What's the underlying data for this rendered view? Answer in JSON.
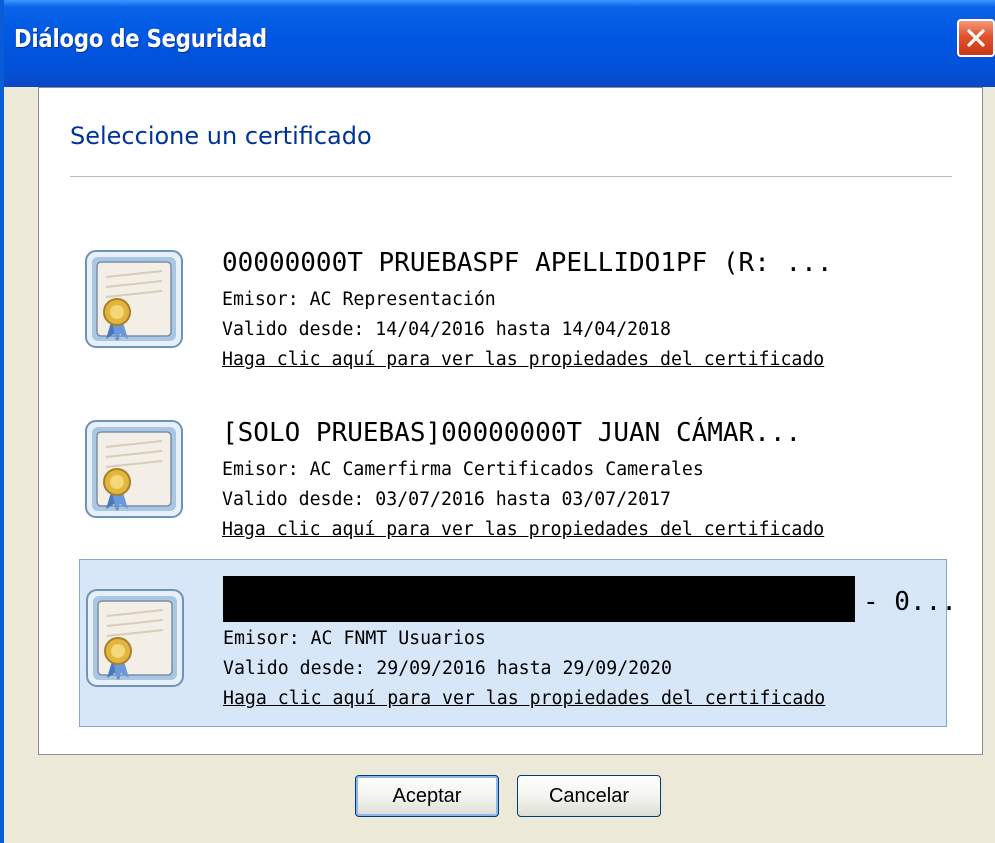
{
  "window": {
    "title": "Diálogo de Seguridad"
  },
  "dialog": {
    "heading": "Seleccione un certificado",
    "certificates": [
      {
        "name": "00000000T PRUEBASPF APELLIDO1PF (R: ...",
        "issuer": "Emisor: AC Representación",
        "validity": "Valido desde: 14/04/2016 hasta 14/04/2018",
        "link": "Haga clic aquí para ver las propiedades del certificado",
        "selected": false
      },
      {
        "name": "[SOLO PRUEBAS]00000000T JUAN CÁMAR...",
        "issuer": "Emisor: AC Camerfirma Certificados Camerales",
        "validity": "Valido desde: 03/07/2016 hasta 03/07/2017",
        "link": "Haga clic aquí para ver las propiedades del certificado",
        "selected": false
      },
      {
        "name": "- 0...",
        "issuer": "Emisor: AC FNMT Usuarios",
        "validity": "Valido desde: 29/09/2016 hasta 29/09/2020",
        "link": "Haga clic aquí para ver las propiedades del certificado",
        "selected": true
      }
    ]
  },
  "buttons": {
    "accept": "Aceptar",
    "cancel": "Cancelar"
  },
  "icons": {
    "close": "close-icon",
    "certificate": "certificate-icon"
  },
  "colors": {
    "title_bar": "#0058e3",
    "heading": "#003399",
    "selection": "#d8e7f8",
    "close_button": "#e1522c"
  }
}
